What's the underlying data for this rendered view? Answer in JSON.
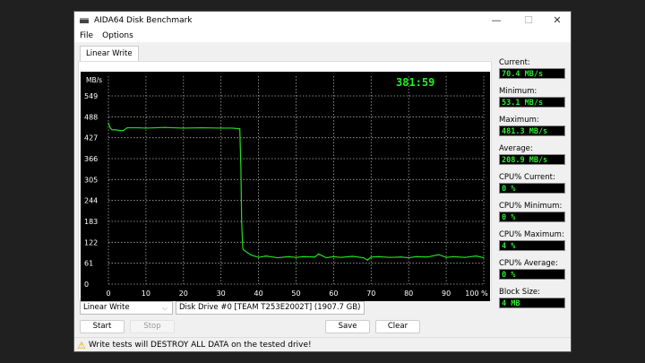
{
  "window": {
    "title": "AIDA64 Disk Benchmark",
    "minimize": "—",
    "maximize": "☐",
    "close": "✕"
  },
  "menu": [
    "File",
    "Options"
  ],
  "tab": "Linear Write",
  "stats": [
    {
      "label": "Current:",
      "value": "70.4 MB/s"
    },
    {
      "label": "Minimum:",
      "value": "53.1 MB/s"
    },
    {
      "label": "Maximum:",
      "value": "481.3 MB/s"
    },
    {
      "label": "Average:",
      "value": "208.9 MB/s"
    },
    {
      "label": "CPU% Current:",
      "value": "0 %"
    },
    {
      "label": "CPU% Minimum:",
      "value": "0 %"
    },
    {
      "label": "CPU% Maximum:",
      "value": "4 %"
    },
    {
      "label": "CPU% Average:",
      "value": "0 %"
    },
    {
      "label": "Block Size:",
      "value": "4 MB"
    }
  ],
  "controls": {
    "test_select": "Linear Write",
    "drive_select": "Disk Drive #0  [TEAM T253E2002T]  (1907.7 GB)",
    "start": "Start",
    "stop": "Stop",
    "save": "Save",
    "clear": "Clear"
  },
  "status": "Write tests will DESTROY ALL DATA on the tested drive!",
  "colors": {
    "line": "#22dd22",
    "timer": "#22ee22",
    "background": "#000000"
  },
  "chart_data": {
    "type": "line",
    "ylabel": "MB/s",
    "timer": "381:59",
    "ylim": [
      0,
      549
    ],
    "xlim": [
      0,
      100
    ],
    "yticks": [
      "0",
      "61",
      "122",
      "183",
      "244",
      "305",
      "366",
      "427",
      "488",
      "549"
    ],
    "xticks": [
      "0",
      "10",
      "20",
      "30",
      "40",
      "50",
      "60",
      "70",
      "80",
      "90",
      "100 %"
    ],
    "grid": true,
    "x": [
      0,
      0.5,
      1,
      2,
      3,
      4,
      5,
      8,
      10,
      15,
      20,
      25,
      30,
      33,
      35,
      35.3,
      35.5,
      35.8,
      36,
      37,
      38,
      40,
      42,
      45,
      48,
      50,
      52,
      55,
      56,
      58,
      60,
      62,
      65,
      68,
      69,
      70,
      72,
      75,
      78,
      80,
      82,
      85,
      88,
      90,
      92,
      95,
      98,
      100
    ],
    "y": [
      470,
      455,
      450,
      450,
      448,
      448,
      456,
      456,
      455,
      457,
      455,
      456,
      455,
      455,
      453,
      340,
      180,
      105,
      100,
      92,
      85,
      78,
      82,
      77,
      80,
      78,
      80,
      79,
      88,
      77,
      80,
      78,
      81,
      77,
      70,
      79,
      80,
      78,
      79,
      77,
      80,
      79,
      86,
      78,
      80,
      78,
      82,
      77
    ]
  }
}
